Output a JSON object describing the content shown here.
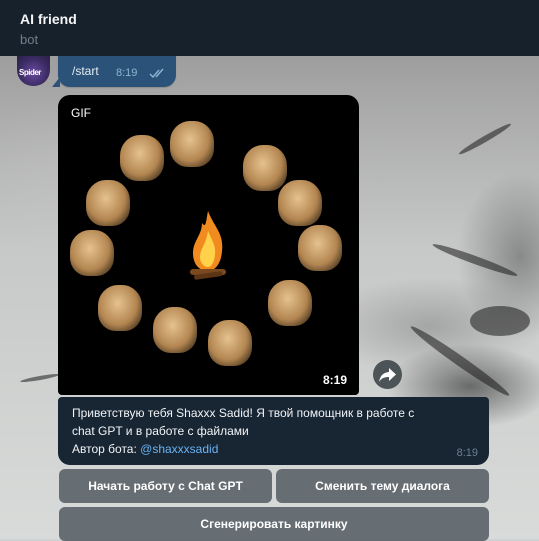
{
  "header": {
    "title": "AI friend",
    "subtitle": "bot"
  },
  "avatar": {
    "text": "Spider"
  },
  "outgoing": {
    "text": "/start",
    "time": "8:19",
    "ticks_icon": "double-check-icon"
  },
  "gif": {
    "label": "GIF",
    "time": "8:19"
  },
  "share": {
    "icon": "forward-arrow-icon"
  },
  "bot_message": {
    "line1": "Приветствую тебя Shaxxx Sadid! Я твой помощник в работе с",
    "line2": "chat GPT и в работе с файлами",
    "line3_prefix": "Автор бота: ",
    "author_link": "@shaxxxsadid",
    "time": "8:19"
  },
  "keyboard": {
    "btn_start": "Начать работу с Chat GPT",
    "btn_topic": "Сменить тему диалога",
    "btn_image": "Сгенерировать картинку"
  }
}
